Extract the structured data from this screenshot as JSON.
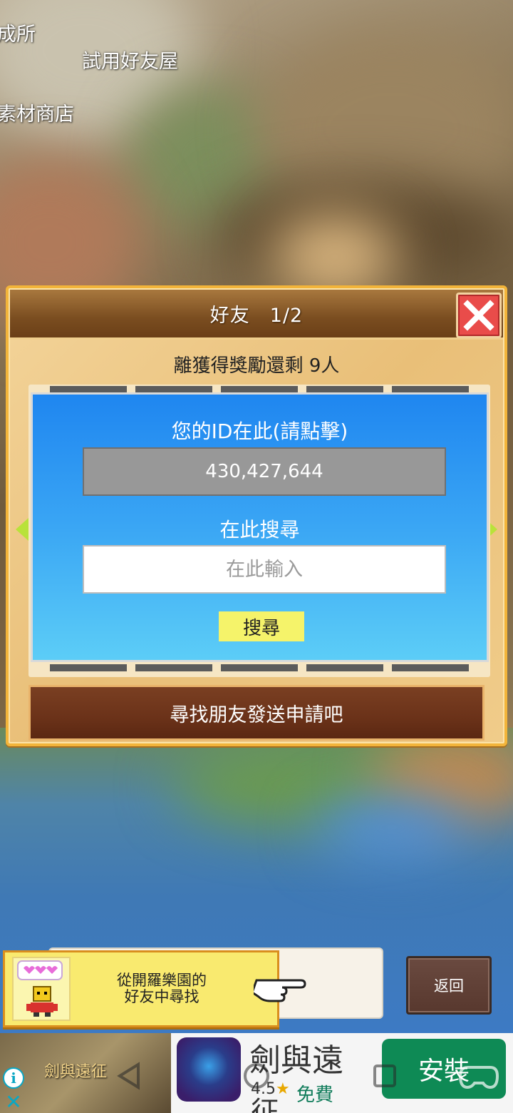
{
  "map_labels": {
    "label_1": "成所",
    "label_2": "試用好友屋",
    "label_3": "素材商店"
  },
  "dialog": {
    "title": "好友　1/2",
    "reward_text": "離獲得獎勵還剩 9人",
    "id_label": "您的ID在此(請點擊)",
    "id_value": "430,427,644",
    "search_label": "在此搜尋",
    "search_input_value": "",
    "search_input_placeholder": "在此輸入",
    "search_button": "搜尋",
    "send_request": "尋找朋友發送申請吧"
  },
  "tip": {
    "line1": "從開羅樂園的",
    "line2": "好友中尋找"
  },
  "back_button": "返回",
  "ad": {
    "logo_text": "劍與遠征",
    "title": "劍與遠",
    "title_overflow": "征",
    "rating": "4.5",
    "free_label": "免費",
    "install_label": "安裝"
  },
  "colors": {
    "header_brown": "#7a4d20",
    "panel_blue": "#1f86f0",
    "search_button_yellow": "#f5f36a",
    "close_red": "#e94c4a",
    "install_green": "#0e8a55"
  },
  "icons": {
    "close": "close-icon",
    "prev": "arrow-left-icon",
    "next": "arrow-right-icon",
    "hand": "pointing-hand-icon",
    "nav_back": "nav-back-icon",
    "nav_home": "nav-home-icon",
    "nav_recents": "nav-recents-icon",
    "nav_game": "game-controller-icon"
  }
}
